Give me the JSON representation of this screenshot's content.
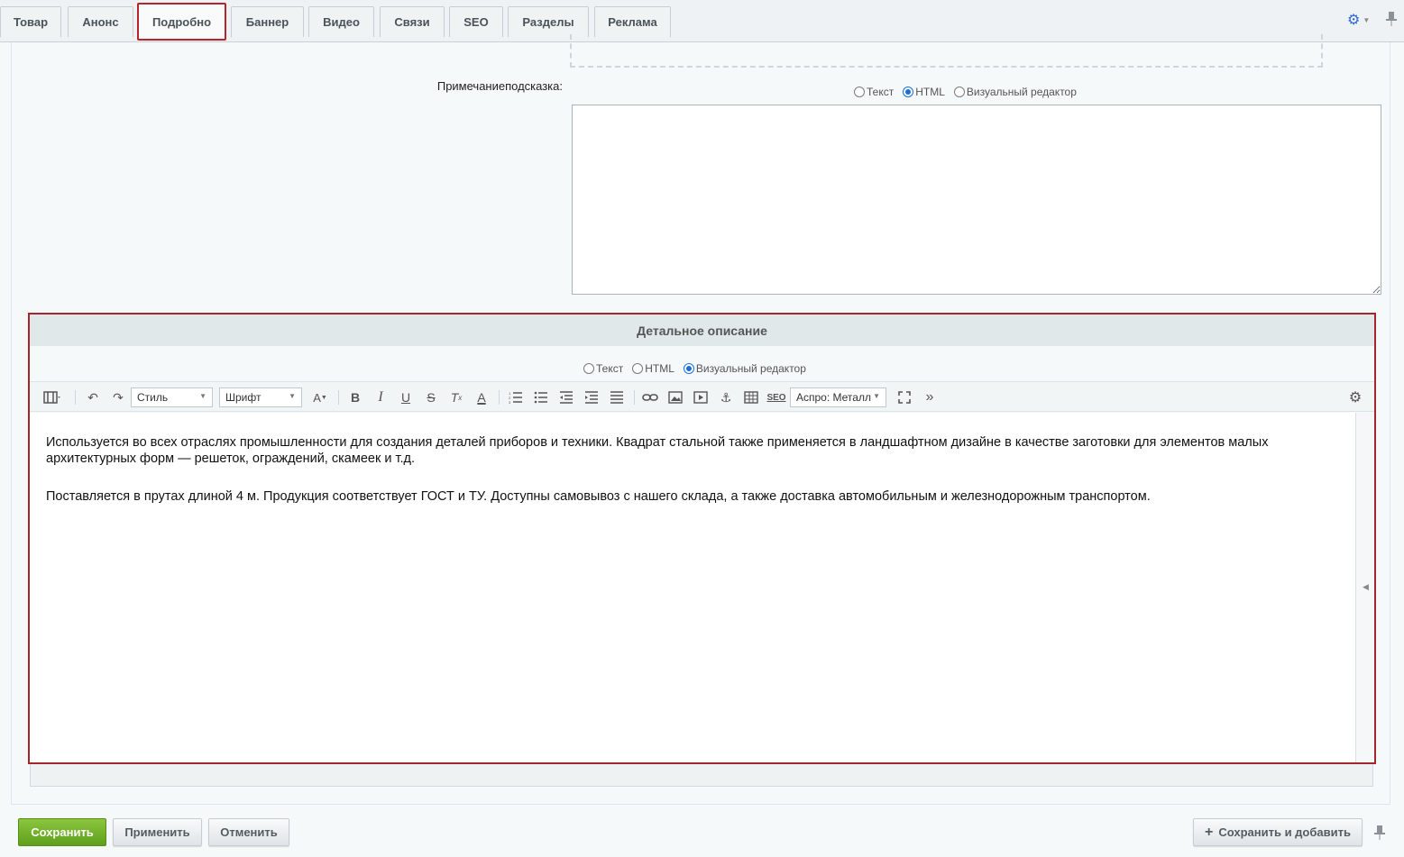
{
  "tabs": [
    {
      "label": "Товар"
    },
    {
      "label": "Анонс"
    },
    {
      "label": "Подробно",
      "active": true
    },
    {
      "label": "Баннер"
    },
    {
      "label": "Видео"
    },
    {
      "label": "Связи"
    },
    {
      "label": "SEO"
    },
    {
      "label": "Разделы"
    },
    {
      "label": "Реклама"
    }
  ],
  "note": {
    "label": "Примечаниеподсказка:",
    "mode_options": [
      "Текст",
      "HTML",
      "Визуальный редактор"
    ],
    "selected_mode": "HTML",
    "value": ""
  },
  "detail": {
    "header": "Детальное описание",
    "mode_options": [
      "Текст",
      "HTML",
      "Визуальный редактор"
    ],
    "selected_mode": "Визуальный редактор",
    "toolbar": {
      "style_select": "Стиль",
      "font_select": "Шрифт",
      "template_select": "Аспро: Металл",
      "seo_label": "SEO"
    },
    "paragraphs": [
      "Используется во всех отраслях промышленности для создания деталей приборов и техники. Квадрат стальной также применяется в ландшафтном дизайне в качестве заготовки для элементов малых архитектурных форм — решеток, ограждений, скамеек и т.д.",
      "Поставляется в прутах длиной 4 м. Продукция соответствует ГОСТ и ТУ. Доступны самовывоз с нашего склада, а также доставка автомобильным и железнодорожным транспортом."
    ]
  },
  "buttons": {
    "save": "Сохранить",
    "apply": "Применить",
    "cancel": "Отменить",
    "save_and_add": "Сохранить и добавить"
  },
  "colors": {
    "highlight": "#b8242a",
    "save_button": "#6aab23",
    "radio_accent": "#1a6fd6"
  }
}
